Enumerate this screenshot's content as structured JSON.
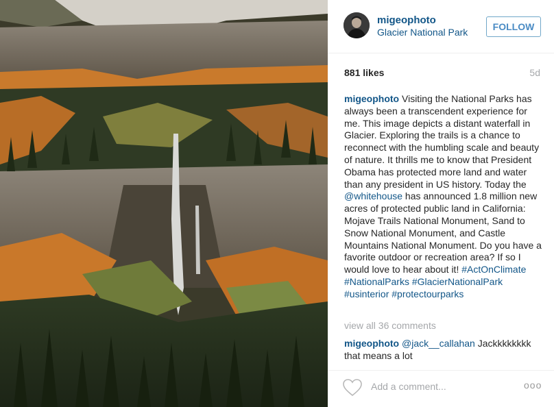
{
  "post": {
    "username": "migeophoto",
    "location": "Glacier National Park",
    "follow_label": "FOLLOW",
    "likes": "881 likes",
    "time": "5d"
  },
  "caption": {
    "username": "migeophoto",
    "text_1": "Visiting the National Parks has always been a transcendent experience for me. This image depicts a distant waterfall in Glacier. Exploring the trails is a chance to reconnect with the humbling scale and beauty of nature. It thrills me to know that President Obama has protected more land and water than any president in US history. Today the ",
    "mention": "@whitehouse",
    "text_2": " has announced 1.8 million new acres of protected public land in California: Mojave Trails National Monument, Sand to Snow National Monument, and Castle Mountains National Monument. Do you have a favorite outdoor or recreation area? If so I would love to hear about it! ",
    "hashtags": [
      "#ActOnClimate",
      "#NationalParks",
      "#GlacierNationalPark",
      "#usinterior",
      "#protectourparks"
    ]
  },
  "view_all": "view all 36 comments",
  "comment": {
    "username": "migeophoto",
    "mention": "@jack__callahan",
    "text": " Jackkkkkkkk that means a lot"
  },
  "footer": {
    "add_placeholder": "Add a comment...",
    "more": "ooo"
  },
  "icons": [
    "heart-icon",
    "more-options-icon"
  ]
}
